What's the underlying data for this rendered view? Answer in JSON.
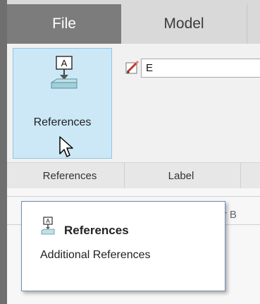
{
  "tabs": {
    "file_label": "File",
    "model_label": "Model"
  },
  "ribbon": {
    "references_button_label": "References",
    "label_input_value": "E",
    "groups": {
      "references_label": "References",
      "label_label": "Label"
    }
  },
  "background": {
    "partial_tab_text": "der B"
  },
  "tooltip": {
    "title": "References",
    "description": "Additional References"
  },
  "icons": {
    "references": "references-icon",
    "pencil": "pencil-icon",
    "cursor": "cursor-icon"
  },
  "colors": {
    "file_tab": "#7c7c7c",
    "selected_button": "#cce8f7",
    "selected_border": "#93c4e6"
  }
}
